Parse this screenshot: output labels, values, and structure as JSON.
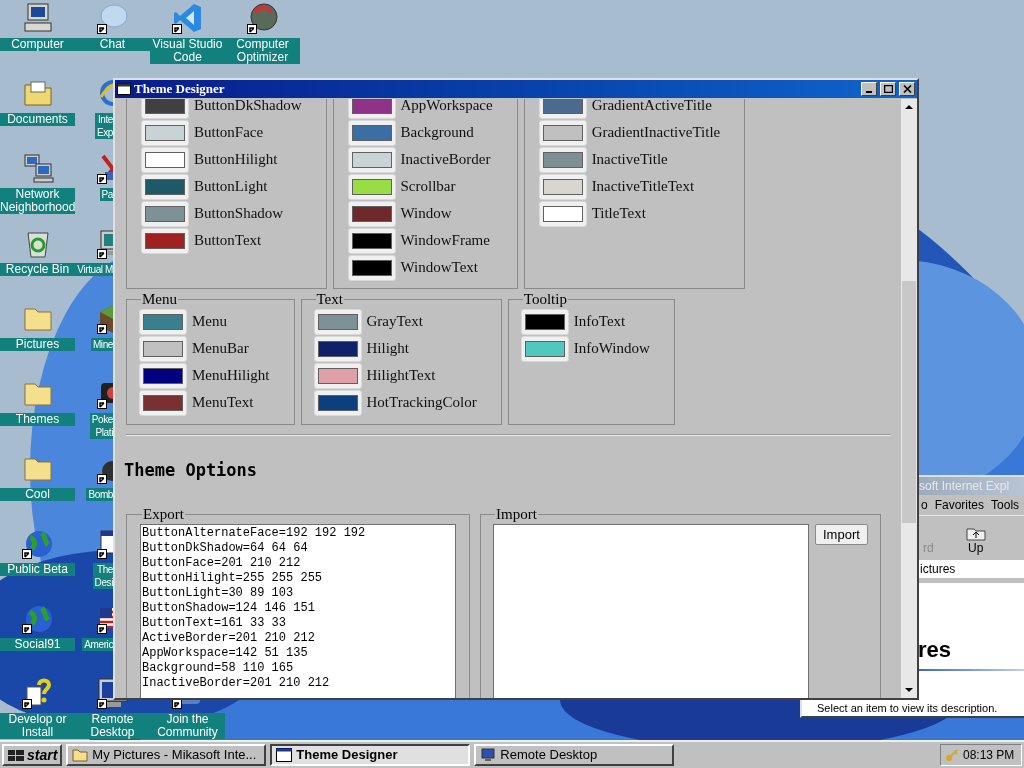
{
  "desktop": {
    "columns": [
      [
        {
          "lines": [
            "Computer"
          ],
          "kind": "computer",
          "shortcut": false,
          "clipped": false
        },
        {
          "lines": [
            "Documents"
          ],
          "kind": "documents",
          "shortcut": false,
          "clipped": false
        },
        {
          "lines": [
            "Network",
            "Neighborhood"
          ],
          "kind": "network",
          "shortcut": false,
          "clipped": false
        },
        {
          "lines": [
            "Recycle Bin"
          ],
          "kind": "recycle",
          "shortcut": false,
          "clipped": false
        },
        {
          "lines": [
            "Pictures"
          ],
          "kind": "folder",
          "shortcut": false,
          "clipped": false
        },
        {
          "lines": [
            "Themes"
          ],
          "kind": "folder",
          "shortcut": false,
          "clipped": false
        },
        {
          "lines": [
            "Cool"
          ],
          "kind": "folder",
          "shortcut": false,
          "clipped": false
        },
        {
          "lines": [
            "Public Beta"
          ],
          "kind": "beta",
          "shortcut": true,
          "clipped": false
        },
        {
          "lines": [
            "Social91"
          ],
          "kind": "globe",
          "shortcut": true,
          "clipped": false
        },
        {
          "lines": [
            "Develop or",
            "Install"
          ],
          "kind": "help",
          "shortcut": true,
          "clipped": false
        }
      ],
      [
        {
          "lines": [
            "Chat"
          ],
          "kind": "chat",
          "shortcut": true,
          "clipped": false
        },
        {
          "lines": [
            "Inte",
            "Exp"
          ],
          "kind": "browser",
          "shortcut": false,
          "clipped": true
        },
        {
          "lines": [
            "Pa"
          ],
          "kind": "paint",
          "shortcut": true,
          "clipped": true
        },
        {
          "lines": [
            "Virtual M"
          ],
          "kind": "monitor",
          "shortcut": true,
          "clipped": true
        },
        {
          "lines": [
            "Mine"
          ],
          "kind": "block",
          "shortcut": true,
          "clipped": true
        },
        {
          "lines": [
            "Poke",
            "Plati"
          ],
          "kind": "game",
          "shortcut": true,
          "clipped": true
        },
        {
          "lines": [
            "Bomb"
          ],
          "kind": "bomb",
          "shortcut": true,
          "clipped": true
        },
        {
          "lines": [
            "The",
            "Desi"
          ],
          "kind": "window",
          "shortcut": true,
          "clipped": true
        },
        {
          "lines": [
            "Americ"
          ],
          "kind": "flag",
          "shortcut": true,
          "clipped": true
        },
        {
          "lines": [
            "Remote",
            "Desktop"
          ],
          "kind": "remote",
          "shortcut": true,
          "clipped": false
        }
      ],
      [
        {
          "lines": [
            "Visual Studio",
            "Code"
          ],
          "kind": "code",
          "shortcut": true,
          "clipped": false
        },
        {
          "lines": [
            "Join the",
            "Community"
          ],
          "kind": "people",
          "shortcut": true,
          "clipped": false
        }
      ],
      [
        {
          "lines": [
            "Computer",
            "Optimizer"
          ],
          "kind": "gauge",
          "shortcut": true,
          "clipped": false
        }
      ]
    ]
  },
  "browser_window": {
    "title": "soft Internet Expl",
    "menu": [
      "o",
      "Favorites",
      "Tools"
    ],
    "toolbar": [
      {
        "label": "rd",
        "disabled": true
      },
      {
        "label": "Up",
        "disabled": false
      }
    ],
    "address": "ictures",
    "heading": "res",
    "description": "Select an item to view its description."
  },
  "window": {
    "title": "Theme Designer",
    "groups": [
      {
        "items": [
          {
            "name": "ButtonDkShadow",
            "color": "#404040"
          },
          {
            "name": "ButtonFace",
            "color": "#c9d2d4"
          },
          {
            "name": "ButtonHilight",
            "color": "#ffffff"
          },
          {
            "name": "ButtonLight",
            "color": "#1e5967"
          },
          {
            "name": "ButtonShadow",
            "color": "#7c9297"
          },
          {
            "name": "ButtonText",
            "color": "#a12121"
          }
        ]
      },
      {
        "items": [
          {
            "name": "AppWorkspace",
            "color": "#8e3387"
          },
          {
            "name": "Background",
            "color": "#3a6ea5"
          },
          {
            "name": "InactiveBorder",
            "color": "#c9d2d4"
          },
          {
            "name": "Scrollbar",
            "color": "#99dd44"
          },
          {
            "name": "Window",
            "color": "#6e2a2a"
          },
          {
            "name": "WindowFrame",
            "color": "#000000"
          },
          {
            "name": "WindowText",
            "color": "#000000"
          }
        ]
      },
      {
        "items": [
          {
            "name": "GradientActiveTitle",
            "color": "#4a6a8f"
          },
          {
            "name": "GradientInactiveTitle",
            "color": "#c0c0c0"
          },
          {
            "name": "InactiveTitle",
            "color": "#7e8f93"
          },
          {
            "name": "InactiveTitleText",
            "color": "#d8d6d0"
          },
          {
            "name": "TitleText",
            "color": "#ffffff"
          }
        ]
      },
      {
        "title": "Menu",
        "items": [
          {
            "name": "Menu",
            "color": "#3a7f8e"
          },
          {
            "name": "MenuBar",
            "color": "#c0c0c0"
          },
          {
            "name": "MenuHilight",
            "color": "#000080"
          },
          {
            "name": "MenuText",
            "color": "#7a3030"
          }
        ]
      },
      {
        "title": "Text",
        "items": [
          {
            "name": "GrayText",
            "color": "#7e9194"
          },
          {
            "name": "Hilight",
            "color": "#10206a"
          },
          {
            "name": "HilightText",
            "color": "#e0a0a8"
          },
          {
            "name": "HotTrackingColor",
            "color": "#0a4080"
          }
        ]
      },
      {
        "title": "Tooltip",
        "items": [
          {
            "name": "InfoText",
            "color": "#000000"
          },
          {
            "name": "InfoWindow",
            "color": "#50c8c0"
          }
        ]
      }
    ],
    "section_title": "Theme Options",
    "export": {
      "legend": "Export",
      "lines": [
        "ButtonAlternateFace=192 192 192",
        "ButtonDkShadow=64 64 64",
        "ButtonFace=201 210 212",
        "ButtonHilight=255 255 255",
        "ButtonLight=30 89 103",
        "ButtonShadow=124 146 151",
        "ButtonText=161 33 33",
        "ActiveBorder=201 210 212",
        "AppWorkspace=142 51 135",
        "Background=58 110 165",
        "InactiveBorder=201 210 212"
      ]
    },
    "import": {
      "legend": "Import",
      "button": "Import"
    }
  },
  "taskbar": {
    "start": "start",
    "tasks": [
      {
        "label": "My Pictures - Mikasoft Inte...",
        "kind": "folder",
        "selected": false
      },
      {
        "label": "Theme Designer",
        "kind": "window",
        "selected": true
      },
      {
        "label": "Remote Desktop",
        "kind": "remote",
        "selected": false
      }
    ],
    "clock": "08:13 PM"
  }
}
